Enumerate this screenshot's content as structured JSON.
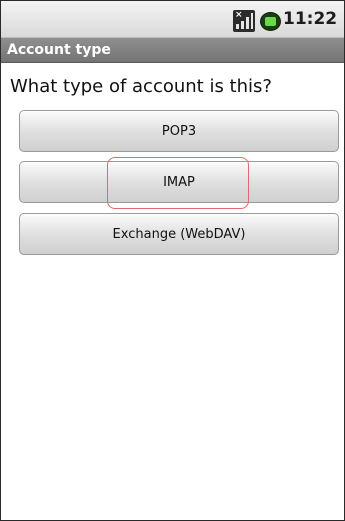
{
  "status_bar": {
    "time": "11:22",
    "signal_icon": "signal-strength-icon",
    "battery_icon": "battery-icon"
  },
  "title_bar": {
    "title": "Account type"
  },
  "prompt": {
    "text": "What type of account is this?"
  },
  "options": [
    {
      "label": "POP3"
    },
    {
      "label": "IMAP"
    },
    {
      "label": "Exchange (WebDAV)"
    }
  ],
  "colors": {
    "highlight": "#e26a6a",
    "title_bar": "#7f7f7f",
    "status_bar": "#e6e6e6"
  }
}
